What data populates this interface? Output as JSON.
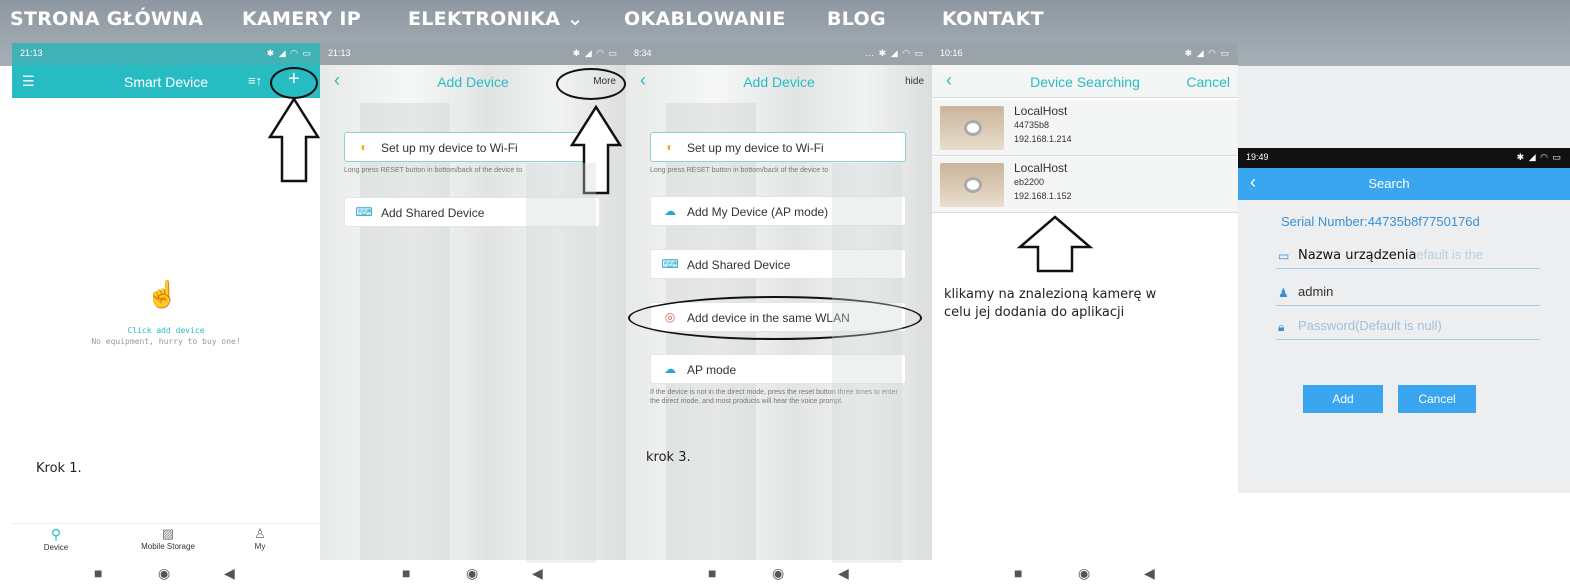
{
  "nav": {
    "items": [
      "STRONA GŁÓWNA",
      "KAMERY IP",
      "ELEKTRONIKA ⌄",
      "OKABLOWANIE",
      "BLOG",
      "KONTAKT"
    ]
  },
  "colors": {
    "teal": "#27bcc2",
    "accent_blue": "#3a90d6",
    "search_header": "#39a6ef"
  },
  "screen1": {
    "time": "21:13",
    "title": "Smart Device",
    "empty_main": "Click add device",
    "empty_sub": "No equipment, hurry to buy one!",
    "annotation": "Krok 1.",
    "tabs": [
      "Device",
      "Mobile Storage",
      "My"
    ],
    "icons": [
      "menu-icon",
      "sort-icon",
      "add-icon",
      "hand-pointer-icon"
    ]
  },
  "screen2": {
    "time": "21:13",
    "title": "Add Device",
    "more": "More",
    "wifi_option": "Set up my device to Wi-Fi",
    "wifi_hint": "Long press RESET button in bottom/back of the device to",
    "shared_option": "Add Shared Device"
  },
  "screen3": {
    "time": "8:34",
    "title": "Add Device",
    "hide": "hide",
    "wifi_option": "Set up my device to Wi-Fi",
    "wifi_hint": "Long press RESET button in bottom/back of the device to",
    "ap_option": "Add My Device (AP mode)",
    "shared_option": "Add Shared Device",
    "wlan_option": "Add device in the same WLAN",
    "apmode_option": "AP mode",
    "apmode_hint": "If the device is not in the direct mode, press the reset button three times to enter the direct mode, and most products will hear the voice prompt.",
    "annotation": "krok 3."
  },
  "screen4": {
    "time": "10:16",
    "title": "Device Searching",
    "cancel": "Cancel",
    "devices": [
      {
        "name": "LocalHost",
        "id": "44735b8",
        "ip": "192.168.1.214"
      },
      {
        "name": "LocalHost",
        "id": "eb2200",
        "ip": "192.168.1.152"
      }
    ],
    "annotation_line1": "klikamy na znalezioną kamerę w",
    "annotation_line2": "celu jej dodania do aplikacji"
  },
  "screen5": {
    "time": "19:49",
    "title": "Search",
    "serial": "Serial Number:44735b8f7750176d",
    "device_name": "Nazwa urządzenia",
    "device_name_ghost": "efault is the",
    "username": "admin",
    "password_placeholder": "Password(Default is null)",
    "add": "Add",
    "cancel": "Cancel"
  }
}
